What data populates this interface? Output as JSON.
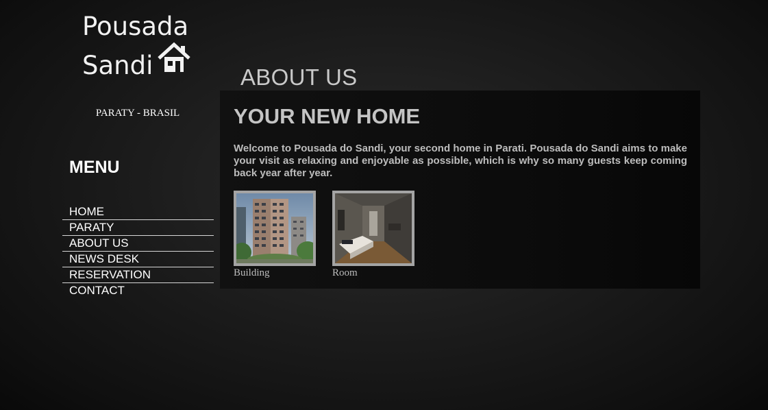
{
  "logo": {
    "line1": "Pousada",
    "line2": "Sandi",
    "icon": "house-icon"
  },
  "location": "PARATY - BRASIL",
  "menu": {
    "title": "MENU",
    "items": [
      {
        "label": "HOME"
      },
      {
        "label": "PARATY"
      },
      {
        "label": "ABOUT US"
      },
      {
        "label": "NEWS DESK"
      },
      {
        "label": "RESERVATION"
      },
      {
        "label": "CONTACT"
      }
    ]
  },
  "page_heading": "ABOUT US",
  "content": {
    "title": "YOUR NEW HOME",
    "intro": "Welcome to Pousada do Sandi, your second home in Parati. Pousada do Sandi aims to make your visit as relaxing and enjoyable as possible, which is why so many guests keep coming back year after year.",
    "photos": [
      {
        "caption": "Building"
      },
      {
        "caption": "Room"
      }
    ]
  },
  "colors": {
    "heading": "#c9c9c9",
    "text": "#bdbdbd",
    "frame": "#a4a4a4",
    "panel": "#0d0d0d"
  }
}
